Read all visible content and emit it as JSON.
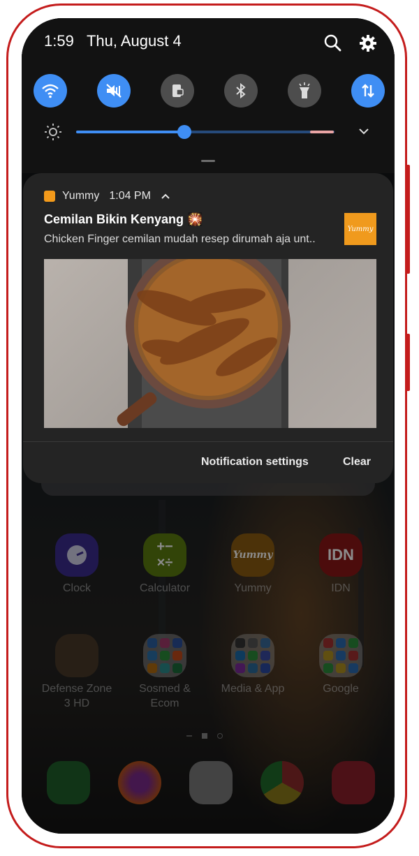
{
  "status_bar": {
    "time": "1:59",
    "date": "Thu, August 4"
  },
  "quick_settings": {
    "toggles": [
      {
        "name": "wifi",
        "active": true
      },
      {
        "name": "sound",
        "active": true
      },
      {
        "name": "rotation",
        "active": false
      },
      {
        "name": "bluetooth",
        "active": false
      },
      {
        "name": "flashlight",
        "active": false
      },
      {
        "name": "mobile-data",
        "active": true
      }
    ],
    "brightness_level": 0.42
  },
  "notification": {
    "app_name": "Yummy",
    "time": "1:04 PM",
    "title": "Cemilan Bikin Kenyang 🎇",
    "text": "Chicken Finger cemilan mudah resep dirumah aja unt..",
    "thumbnail_text": "Yummy",
    "actions": {
      "settings": "Notification settings",
      "clear": "Clear"
    }
  },
  "home_screen": {
    "apps_row1": [
      {
        "label": "Clock",
        "color": "#3b2d8f"
      },
      {
        "label": "Calculator",
        "color": "#5c7d10"
      },
      {
        "label": "Yummy",
        "color": "#8a5b12"
      },
      {
        "label": "IDN",
        "color": "#8b1616",
        "icon_text": "IDN"
      }
    ],
    "apps_row2": [
      {
        "label": "Defense Zone 3 HD"
      },
      {
        "label": "Sosmed & Ecom"
      },
      {
        "label": "Media & App"
      },
      {
        "label": "Google"
      }
    ],
    "dock": [
      {
        "name": "phone"
      },
      {
        "name": "firefox"
      },
      {
        "name": "play-store"
      },
      {
        "name": "chrome"
      },
      {
        "name": "camera"
      }
    ]
  },
  "colors": {
    "accent": "#3f8ef4",
    "frame": "#c41c1c",
    "notification_bg": "#242424"
  }
}
